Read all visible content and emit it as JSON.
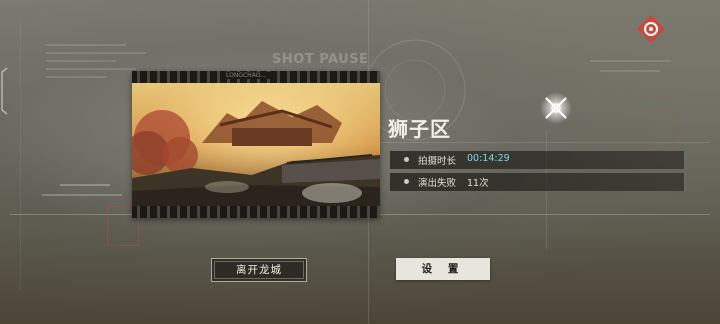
{
  "watermark": {
    "text": "SHOT PAUSE"
  },
  "film": {
    "caption": "LONGCHAO..."
  },
  "level": {
    "name": "狮子区"
  },
  "stats": [
    {
      "label": "拍摄时长",
      "value": "00:14:29",
      "value_color": "#7fd8e4"
    },
    {
      "label": "演出失败",
      "value": "11次",
      "value_color": "#e2ded3"
    }
  ],
  "buttons": {
    "leave": "离开龙城",
    "settings": "设 置"
  },
  "icons": {
    "top_right": "red-target-badge-icon",
    "sparkle": "glowing-crosshair-emblem-icon",
    "left_edge": "left-bracket-icon"
  },
  "colors": {
    "accent_cyan": "#7fd8e4",
    "badge_red": "#c84a3d"
  }
}
